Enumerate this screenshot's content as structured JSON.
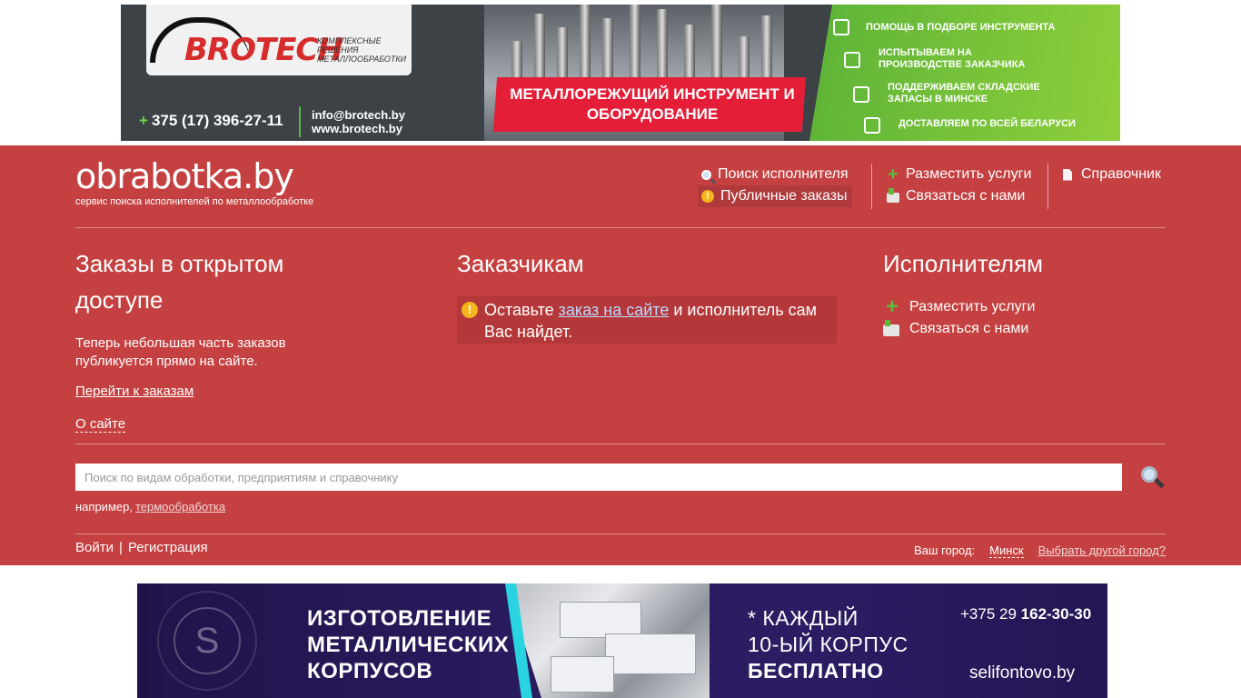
{
  "top_banner": {
    "logo": "BROTECH",
    "logo_sub": "КОМПЛЕКСНЫЕ РЕШЕНИЯ МЕТАЛЛООБРАБОТКИ",
    "phone": "375 (17) 396-27-11",
    "email": "info@brotech.by",
    "site": "www.brotech.by",
    "headline": "МЕТАЛЛОРЕЖУЩИЙ ИНСТРУМЕНТ И ОБОРУДОВАНИЕ",
    "features": [
      "ПОМОЩЬ В ПОДБОРЕ ИНСТРУМЕНТА",
      "ИСПЫТЫВАЕМ НА ПРОИЗВОДСТВЕ ЗАКАЗЧИКА",
      "ПОДДЕРЖИВАЕМ СКЛАДСКИЕ ЗАПАСЫ В МИНСКЕ",
      "ДОСТАВЛЯЕМ ПО ВСЕЙ БЕЛАРУСИ"
    ]
  },
  "header": {
    "logo": "obrabotka.by",
    "tagline": "сервис поиска исполнителей по металлообработке",
    "nav": {
      "find_executor": "Поиск исполнителя",
      "public_orders": "Публичные заказы",
      "place_services": "Разместить услуги",
      "contact_us": "Связаться с нами",
      "reference": "Справочник"
    }
  },
  "columns": {
    "orders": {
      "title": "Заказы в открытом доступе",
      "text": "Теперь небольшая часть заказов публикуется прямо на сайте.",
      "link_orders": "Перейти к заказам",
      "link_about": "О сайте"
    },
    "customers": {
      "title": "Заказчикам",
      "notice_before": "Оставьте ",
      "notice_link": "заказ на сайте",
      "notice_after": " и исполнитель сам Вас найдет."
    },
    "executors": {
      "title": "Исполнителям",
      "place_services": "Разместить услуги",
      "contact_us": "Связаться с нами"
    }
  },
  "search": {
    "placeholder": "Поиск по видам обработки, предприятиям и справочнику",
    "example_label": "например,",
    "example_link": "термообработка"
  },
  "auth": {
    "login": "Войти",
    "separator": "|",
    "register": "Регистрация"
  },
  "city": {
    "label": "Ваш город:",
    "value": "Минск",
    "change": "Выбрать другой город?"
  },
  "bottom_banner": {
    "title_lines": [
      "ИЗГОТОВЛЕНИЕ",
      "МЕТАЛЛИЧЕСКИХ",
      "КОРПУСОВ"
    ],
    "promo_line1": "* КАЖДЫЙ",
    "promo_line2": "10-ЫЙ КОРПУС",
    "promo_line3": "БЕСПЛАТНО",
    "phone_prefix": "+375 29 ",
    "phone_number": "162-30-30",
    "site": "selifontovo.by"
  },
  "colors": {
    "header_bg": "#c54041",
    "accent_green": "#5dbb3a",
    "accent_yellow": "#f2b51b",
    "banner_red": "#e51e38"
  }
}
